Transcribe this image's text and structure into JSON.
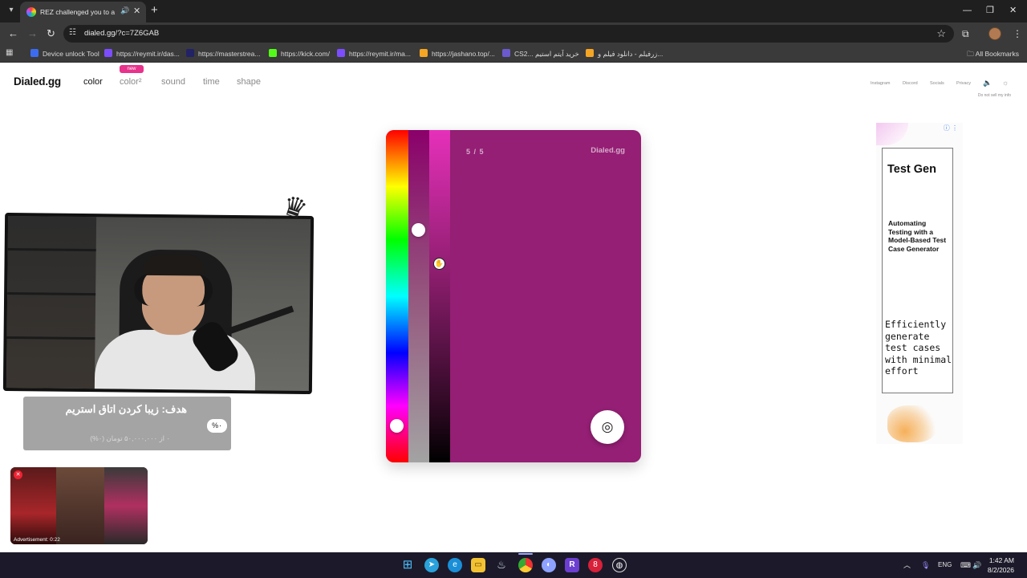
{
  "browser": {
    "tab": {
      "title": "REZ challenged you to a co",
      "audio_icon": "speaker-icon",
      "close_icon": "close-icon"
    },
    "new_tab_label": "+",
    "window_controls": [
      "minimize-icon",
      "restore-icon",
      "close-icon"
    ],
    "url": "dialed.gg/?c=7Z6GAB",
    "bookmarks": [
      {
        "label": "Device unlock Tool",
        "color": "#3b6cf0"
      },
      {
        "label": "https://reymit.ir/das...",
        "color": "#7c4dff"
      },
      {
        "label": "https://masterstrea...",
        "color": "#222266"
      },
      {
        "label": "https://kick.com/",
        "color": "#53fc18"
      },
      {
        "label": "https://reymit.ir/ma...",
        "color": "#7c4dff"
      },
      {
        "label": "https://jashano.top/...",
        "color": "#f5a623"
      },
      {
        "label": "CS2... خرید آیتم استیم",
        "color": "#6a5acd"
      },
      {
        "label": "زرفیلم - دانلود فیلم و...",
        "color": "#f5a623"
      }
    ],
    "all_bookmarks": "All Bookmarks"
  },
  "site": {
    "logo": "Dialed.gg",
    "nav": [
      {
        "label": "color",
        "active": true
      },
      {
        "label": "color²",
        "active": false
      },
      {
        "label": "sound",
        "active": false
      },
      {
        "label": "time",
        "active": false
      },
      {
        "label": "shape",
        "active": false
      }
    ],
    "new_badge": "new",
    "top_links": [
      "Instagram",
      "Discord",
      "Socials",
      "Privacy"
    ],
    "do_not_sell": "Do not sell my info"
  },
  "game": {
    "round": "5 / 5",
    "brand": "Dialed.gg",
    "target_color": "#941f74",
    "hue_knob_level": 0.15,
    "saturation_knob_level": 0.75
  },
  "ad": {
    "title": "Test Gen",
    "subtitle": "Automating Testing with a Model-Based Test Case Generator",
    "description": "Efficiently generate test cases with minimal effort"
  },
  "stream": {
    "goal_title": "هدف: زیبا کردن اتاق استریم",
    "goal_progress": "۰ از ۵۰,۰۰۰,۰۰۰ تومان (۰%)",
    "goal_percent": "%۰",
    "promo_caption": "Advertisement: 0:22"
  },
  "taskbar": {
    "language": "ENG",
    "time": "1:42 AM",
    "date": "8/2/2026"
  }
}
